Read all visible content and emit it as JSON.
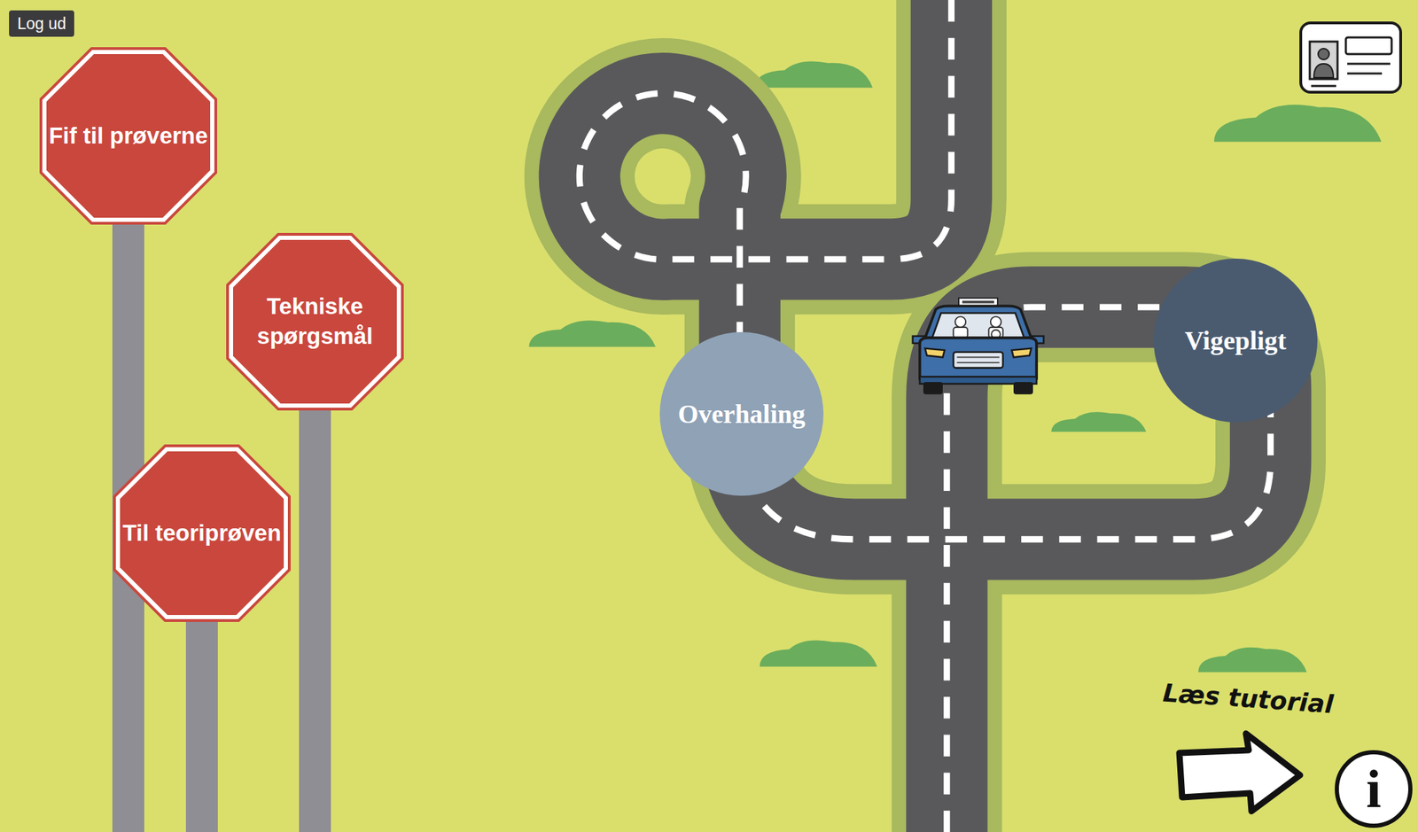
{
  "header": {
    "logout": "Log ud"
  },
  "signs": [
    {
      "label": "Fif til prøverne"
    },
    {
      "label": "Tekniske spørgsmål"
    },
    {
      "label": "Til teoriprøven"
    }
  ],
  "topics": [
    {
      "label": "Overhaling",
      "color": "#8fa2b6"
    },
    {
      "label": "Vigepligt",
      "color": "#4a5b70"
    }
  ],
  "tutorial": {
    "label": "Læs tutorial",
    "info": "i"
  }
}
